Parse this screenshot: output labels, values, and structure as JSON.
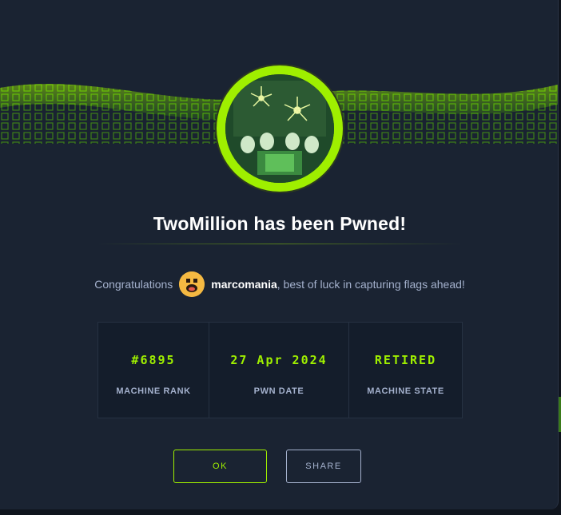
{
  "dialog": {
    "title": "TwoMillion has been Pwned!",
    "congrats_prefix": "Congratulations",
    "username": "marcomania",
    "congrats_suffix": ", best of luck in capturing flags ahead!"
  },
  "stats": [
    {
      "value": "#6895",
      "label": "MACHINE RANK"
    },
    {
      "value": "27 Apr 2024",
      "label": "PWN DATE"
    },
    {
      "value": "RETIRED",
      "label": "MACHINE STATE"
    }
  ],
  "buttons": {
    "ok": "OK",
    "share": "SHARE"
  },
  "colors": {
    "accent": "#9fef00",
    "background": "#1a2332",
    "text_muted": "#a4b1cd"
  }
}
